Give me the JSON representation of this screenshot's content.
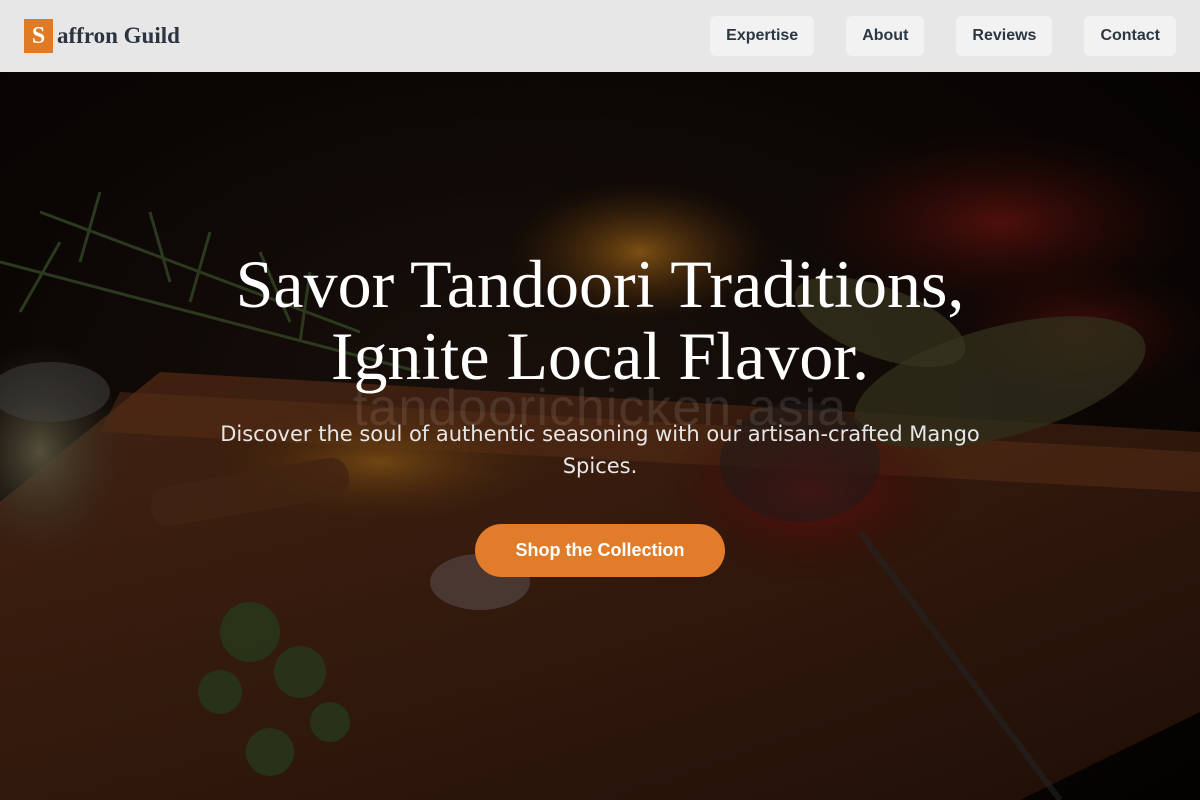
{
  "brand": {
    "initial": "S",
    "name": "affron Guild"
  },
  "nav": {
    "links": [
      {
        "label": "Expertise"
      },
      {
        "label": "About"
      },
      {
        "label": "Reviews"
      },
      {
        "label": "Contact"
      }
    ]
  },
  "hero": {
    "title_line1": "Savor Tandoori Traditions,",
    "title_line2": "Ignite Local Flavor.",
    "watermark": "tandoorichicken.asia",
    "subtitle": "Discover the soul of authentic seasoning with our artisan-crafted Mango Spices.",
    "cta_label": "Shop the Collection",
    "background": "spices-on-cutting-board-photo"
  },
  "colors": {
    "accent": "#e07c2a",
    "nav_bg": "#e7e7e7",
    "nav_text": "#2c3744"
  }
}
